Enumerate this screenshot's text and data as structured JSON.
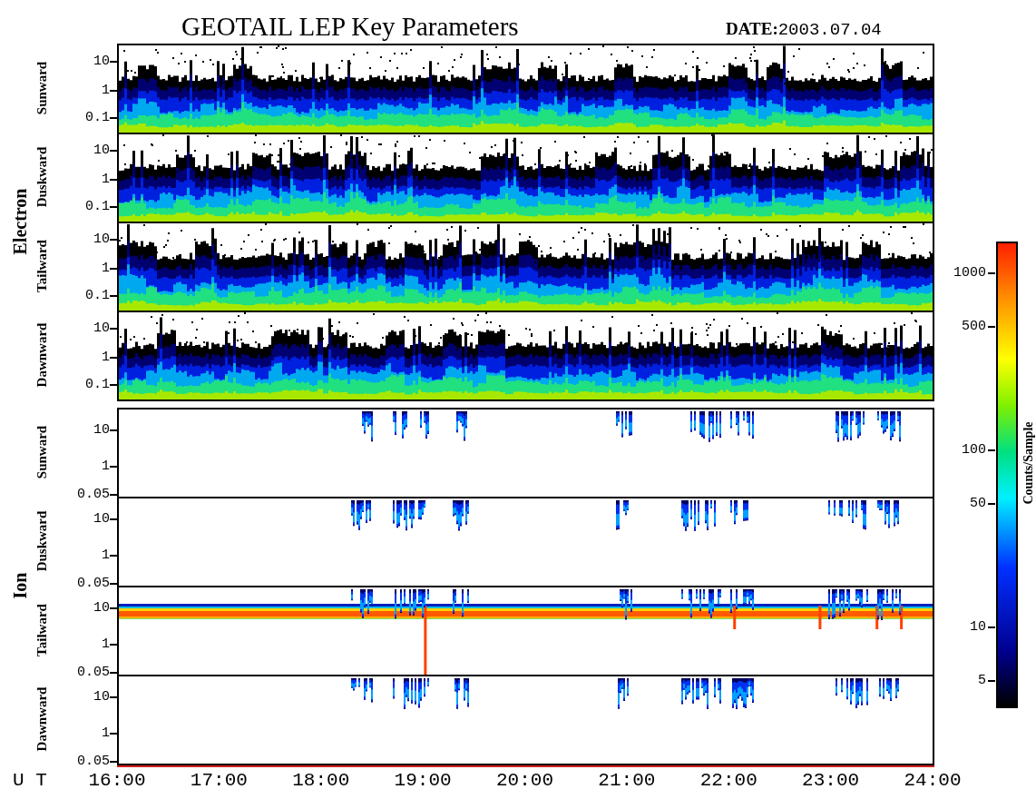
{
  "title": "GEOTAIL LEP Key Parameters",
  "date": {
    "label": "DATE:",
    "value": "2003.07.04"
  },
  "groups": [
    {
      "label": "Electron",
      "kind": "electron",
      "panels": [
        {
          "label": "Sunward",
          "yticks": [
            "10",
            "1",
            "0.1"
          ]
        },
        {
          "label": "Duskward",
          "yticks": [
            "10",
            "1",
            "0.1"
          ]
        },
        {
          "label": "Tailward",
          "yticks": [
            "10",
            "1",
            "0.1"
          ]
        },
        {
          "label": "Dawnward",
          "yticks": [
            "10",
            "1",
            "0.1"
          ]
        }
      ]
    },
    {
      "label": "Ion",
      "kind": "ion",
      "panels": [
        {
          "label": "Sunward",
          "yticks": [
            "10",
            "1",
            "0.05"
          ]
        },
        {
          "label": "Duskward",
          "yticks": [
            "10",
            "1",
            "0.05"
          ]
        },
        {
          "label": "Tailward",
          "yticks": [
            "10",
            "1",
            "0.05"
          ]
        },
        {
          "label": "Dawnward",
          "yticks": [
            "10",
            "1",
            "0.05"
          ]
        }
      ]
    }
  ],
  "colorbar": {
    "label": "Counts/Sample",
    "ticks": [
      "1000",
      "500",
      "100",
      "50",
      "10",
      "5"
    ]
  },
  "time_axis": {
    "label": "U T",
    "ticks": [
      "16:00",
      "17:00",
      "18:00",
      "19:00",
      "20:00",
      "21:00",
      "22:00",
      "23:00",
      "24:00"
    ]
  }
}
